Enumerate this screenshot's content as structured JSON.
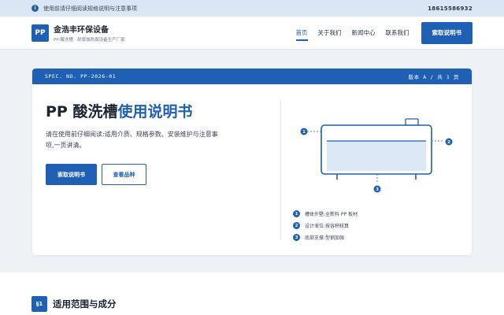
{
  "notice": {
    "text": "使用前请仔细阅读规格说明与注意事项",
    "phone": "18615586932"
  },
  "nav": {
    "logo": "PP",
    "brand_name": "金浩丰环保设备",
    "brand_sub": "PP 酸洗槽 · 耐腐蚀防腐设备生产厂家",
    "menu": [
      {
        "label": "首页",
        "active": true
      },
      {
        "label": "关于我们"
      },
      {
        "label": "新闻中心"
      },
      {
        "label": "联系我们"
      }
    ],
    "cta": "索取说明书"
  },
  "spec": {
    "header_left": "SPEC. NO. PP-2026-01",
    "header_right": "版本 A / 共 1 页",
    "title_plain": "PP 酸洗槽",
    "title_accent": "使用说明书",
    "description": "请在使用前仔细阅读:适用介质、规格参数、安装维护与注意事项,一页讲清。",
    "btn_primary": "索取说明书",
    "btn_secondary": "查看品种",
    "diagram_markers": [
      "1",
      "2",
      "3"
    ],
    "legend": [
      {
        "num": "1",
        "text": "槽体外壁:全新料 PP 板材"
      },
      {
        "num": "2",
        "text": "设计液位:按容积核算"
      },
      {
        "num": "3",
        "text": "底部支撑:型钢加强"
      }
    ]
  },
  "section": {
    "badge": "§1",
    "title": "适用范围与成分"
  }
}
